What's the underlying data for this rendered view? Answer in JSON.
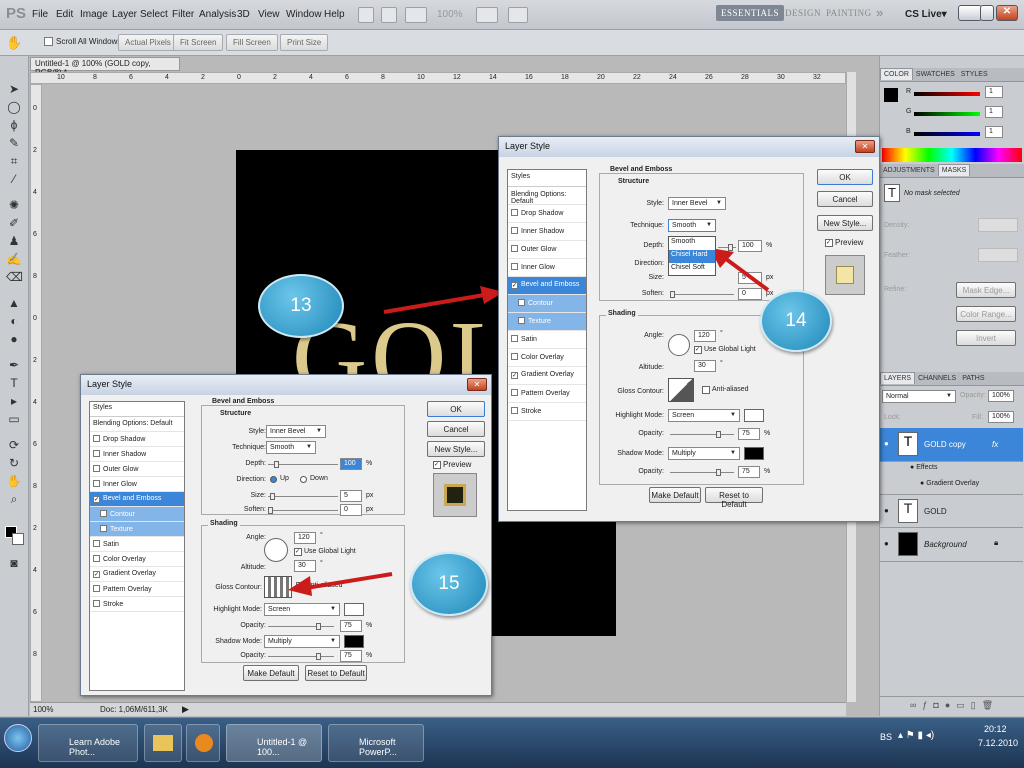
{
  "app": {
    "logo": "PS",
    "menu": [
      "File",
      "Edit",
      "Image",
      "Layer",
      "Select",
      "Filter",
      "Analysis",
      "3D",
      "View",
      "Window",
      "Help"
    ],
    "zoom": "100%",
    "workspaces": [
      "ESSENTIALS",
      "DESIGN",
      "PAINTING"
    ],
    "more": "»",
    "cslive": "CS Live▾"
  },
  "options": {
    "scroll_all": "Scroll All Windows",
    "buttons": [
      "Actual Pixels",
      "Fit Screen",
      "Fill Screen",
      "Print Size"
    ]
  },
  "document": {
    "tab": "Untitled-1 @ 100% (GOLD copy, RGB/8) *",
    "ruler_h": [
      "10",
      "8",
      "6",
      "4",
      "2",
      "0",
      "2",
      "4",
      "6",
      "8",
      "10",
      "12",
      "14",
      "16",
      "18",
      "20",
      "22",
      "24",
      "26",
      "28",
      "30",
      "32"
    ],
    "ruler_v": [
      "0",
      "2",
      "4",
      "6",
      "8",
      "0",
      "2",
      "4",
      "6",
      "8",
      "2",
      "4",
      "6",
      "8"
    ],
    "canvas_text": "GOL",
    "status_zoom": "100%",
    "status_doc": "Doc: 1,06M/611,3K"
  },
  "dialog_small": {
    "title": "Layer Style",
    "styles_header": "Styles",
    "items": [
      {
        "label": "Blending Options: Default",
        "type": "plain"
      },
      {
        "label": "Drop Shadow",
        "type": "cb",
        "checked": false
      },
      {
        "label": "Inner Shadow",
        "type": "cb",
        "checked": false
      },
      {
        "label": "Outer Glow",
        "type": "cb",
        "checked": false
      },
      {
        "label": "Inner Glow",
        "type": "cb",
        "checked": false
      },
      {
        "label": "Bevel and Emboss",
        "type": "sel",
        "checked": true
      },
      {
        "label": "Contour",
        "type": "sub"
      },
      {
        "label": "Texture",
        "type": "sub"
      },
      {
        "label": "Satin",
        "type": "cb",
        "checked": false
      },
      {
        "label": "Color Overlay",
        "type": "cb",
        "checked": false
      },
      {
        "label": "Gradient Overlay",
        "type": "cb",
        "checked": true
      },
      {
        "label": "Pattern Overlay",
        "type": "cb",
        "checked": false
      },
      {
        "label": "Stroke",
        "type": "cb",
        "checked": false
      }
    ],
    "section": "Bevel and Emboss",
    "structure": "Structure",
    "style_label": "Style:",
    "style_val": "Inner Bevel",
    "tech_label": "Technique:",
    "tech_val": "Smooth",
    "depth_label": "Depth:",
    "depth_val": "100",
    "pct": "%",
    "dir_label": "Direction:",
    "up": "Up",
    "down": "Down",
    "size_label": "Size:",
    "size_val": "5",
    "px": "px",
    "soften_label": "Soften:",
    "soften_val": "0",
    "shading": "Shading",
    "angle_label": "Angle:",
    "angle_val": "120",
    "deg": "°",
    "global_light": "Use Global Light",
    "alt_label": "Altitude:",
    "alt_val": "30",
    "gloss_label": "Gloss Contour:",
    "anti": "Anti-aliased",
    "hl_label": "Highlight Mode:",
    "hl_val": "Screen",
    "op_label": "Opacity:",
    "op_val": "75",
    "sh_label": "Shadow Mode:",
    "sh_val": "Multiply",
    "op2_val": "75",
    "ok": "OK",
    "cancel": "Cancel",
    "newstyle": "New Style...",
    "preview": "Preview",
    "make_default": "Make Default",
    "reset_default": "Reset to Default"
  },
  "dialog_big": {
    "title": "Layer Style",
    "technique_options": [
      "Smooth",
      "Chisel Hard",
      "Chisel Soft"
    ]
  },
  "callouts": {
    "c13": "13",
    "c14": "14",
    "c15": "15"
  },
  "panels": {
    "color_tabs": [
      "COLOR",
      "SWATCHES",
      "STYLES"
    ],
    "r": "R",
    "g": "G",
    "b": "B",
    "rv": "1",
    "gv": "1",
    "bv": "1",
    "adj_tabs": [
      "ADJUSTMENTS",
      "MASKS"
    ],
    "no_mask": "No mask selected",
    "density": "Density:",
    "feather": "Feather:",
    "refine": "Refine:",
    "mask_edge": "Mask Edge...",
    "color_range": "Color Range...",
    "invert": "Invert",
    "layer_tabs": [
      "LAYERS",
      "CHANNELS",
      "PATHS"
    ],
    "blend": "Normal",
    "opacity": "Opacity:",
    "opacity_val": "100%",
    "lock": "Lock:",
    "fill": "Fill:",
    "fill_val": "100%",
    "layers": [
      {
        "name": "GOLD copy",
        "selected": true,
        "fx": "fx"
      },
      {
        "name": "GOLD",
        "selected": false
      },
      {
        "name": "Background",
        "selected": false
      }
    ],
    "effects": "Effects",
    "grad": "Gradient Overlay"
  },
  "taskbar": {
    "items": [
      "Learn Adobe Phot...",
      "",
      "",
      "Untitled-1 @ 100...",
      "Microsoft PowerP..."
    ],
    "lang": "BS",
    "time": "20:12",
    "date": "7.12.2010"
  },
  "colors": {
    "accent": "#3b86d8",
    "callout": "#2a9fd1",
    "arrow": "#cc1b1b"
  }
}
